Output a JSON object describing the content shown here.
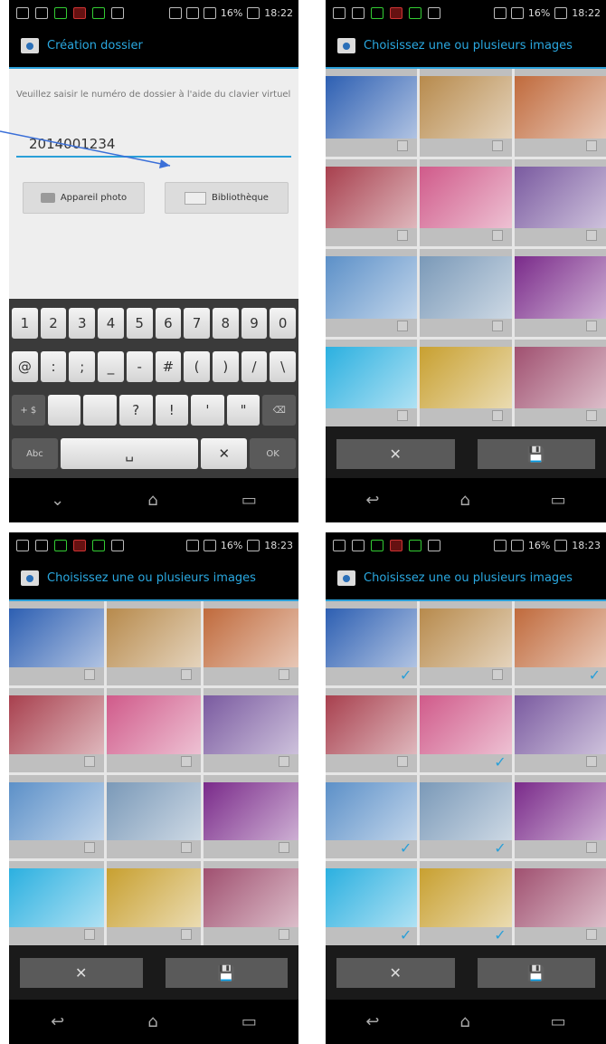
{
  "status": {
    "battery": "16%",
    "time_a": "18:22",
    "time_b": "18:23"
  },
  "screen1": {
    "title": "Création dossier",
    "instruction": "Veuillez saisir le numéro de dossier à l'aide du clavier virtuel",
    "dossier_value": "2014001234",
    "photo_button": "Appareil photo",
    "library_button": "Bibliothèque",
    "keyboard": {
      "row1": [
        "1",
        "2",
        "3",
        "4",
        "5",
        "6",
        "7",
        "8",
        "9",
        "0"
      ],
      "row2": [
        "@",
        ":",
        ";",
        "_",
        "-",
        "#",
        "(",
        ")",
        "/",
        "\\"
      ],
      "row3": [
        "+ $",
        "",
        "",
        "?",
        "!",
        "'",
        "\"",
        "⌫"
      ],
      "row4": [
        "Abc",
        "␣",
        "✕",
        "OK"
      ]
    }
  },
  "gallery": {
    "title": "Choisissez une ou plusieurs images",
    "cancel_symbol": "✕",
    "save_symbol": "💾",
    "thumbnails": [
      "sky-sea",
      "buildings",
      "city",
      "balls",
      "boats",
      "yarn",
      "clouds",
      "mountains",
      "balls2",
      "water",
      "huts",
      "fabric"
    ],
    "colors": [
      "#2d5fb2",
      "#b78a4c",
      "#c06a3c",
      "#a8404e",
      "#d05a8a",
      "#7a5aa0",
      "#5c90c8",
      "#7a99b8",
      "#7a2a8a",
      "#2bb0e0",
      "#c8a030",
      "#a05070"
    ]
  },
  "screen4": {
    "checked": [
      true,
      false,
      true,
      false,
      true,
      false,
      true,
      true,
      false,
      true,
      true,
      false
    ]
  },
  "nav": {
    "back": "↩",
    "home": "⌂",
    "recent": "▭"
  }
}
